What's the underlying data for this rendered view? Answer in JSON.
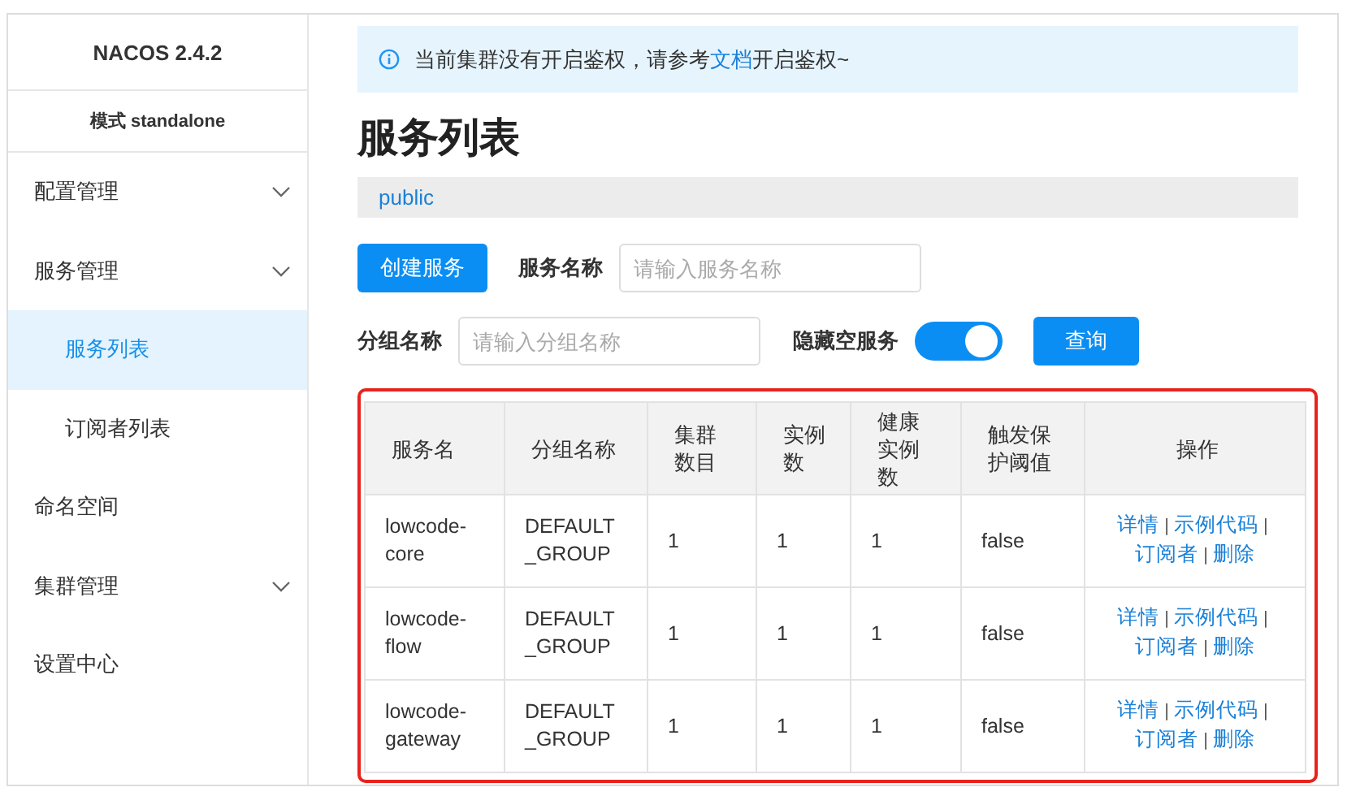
{
  "sidebar": {
    "title": "NACOS 2.4.2",
    "mode": "模式 standalone",
    "items": [
      {
        "label": "配置管理",
        "expandable": true,
        "selected": false
      },
      {
        "label": "服务管理",
        "expandable": true,
        "selected": false,
        "children": [
          {
            "label": "服务列表",
            "selected": true
          },
          {
            "label": "订阅者列表",
            "selected": false
          }
        ]
      },
      {
        "label": "命名空间",
        "expandable": false,
        "selected": false
      },
      {
        "label": "集群管理",
        "expandable": true,
        "selected": false
      },
      {
        "label": "设置中心",
        "expandable": false,
        "selected": false
      }
    ]
  },
  "notice": {
    "before": "当前集群没有开启鉴权，请参考",
    "link": "文档",
    "after": "开启鉴权~"
  },
  "page_title": "服务列表",
  "namespace": "public",
  "filters": {
    "create_button": "创建服务",
    "service_name_label": "服务名称",
    "service_name_placeholder": "请输入服务名称",
    "group_name_label": "分组名称",
    "group_name_placeholder": "请输入分组名称",
    "hide_empty_label": "隐藏空服务",
    "hide_empty_on": true,
    "query_button": "查询"
  },
  "table": {
    "highlighted": true,
    "columns": [
      "服务名",
      "分组名称",
      "集群数目",
      "实例数",
      "健康实例数",
      "触发保护阈值",
      "操作"
    ],
    "rows": [
      {
        "cells": [
          "lowcode-core",
          "DEFAULT_GROUP",
          "1",
          "1",
          "1",
          "false"
        ],
        "actions": [
          {
            "kind": "link",
            "label": "详情"
          },
          {
            "kind": "separator",
            "label": "|"
          },
          {
            "kind": "link",
            "label": "示例代码"
          },
          {
            "kind": "separator",
            "label": "|"
          },
          {
            "kind": "link",
            "label": "订阅者"
          },
          {
            "kind": "separator",
            "label": "|"
          },
          {
            "kind": "link",
            "label": "删除"
          }
        ]
      },
      {
        "cells": [
          "lowcode-flow",
          "DEFAULT_GROUP",
          "1",
          "1",
          "1",
          "false"
        ],
        "actions": [
          {
            "kind": "link",
            "label": "详情"
          },
          {
            "kind": "separator",
            "label": "|"
          },
          {
            "kind": "link",
            "label": "示例代码"
          },
          {
            "kind": "separator",
            "label": "|"
          },
          {
            "kind": "link",
            "label": "订阅者"
          },
          {
            "kind": "separator",
            "label": "|"
          },
          {
            "kind": "link",
            "label": "删除"
          }
        ]
      },
      {
        "cells": [
          "lowcode-gateway",
          "DEFAULT_GROUP",
          "1",
          "1",
          "1",
          "false"
        ],
        "actions": [
          {
            "kind": "link",
            "label": "详情"
          },
          {
            "kind": "separator",
            "label": "|"
          },
          {
            "kind": "link",
            "label": "示例代码"
          },
          {
            "kind": "separator",
            "label": "|"
          },
          {
            "kind": "link",
            "label": "订阅者"
          },
          {
            "kind": "separator",
            "label": "|"
          },
          {
            "kind": "link",
            "label": "删除"
          }
        ]
      }
    ]
  }
}
